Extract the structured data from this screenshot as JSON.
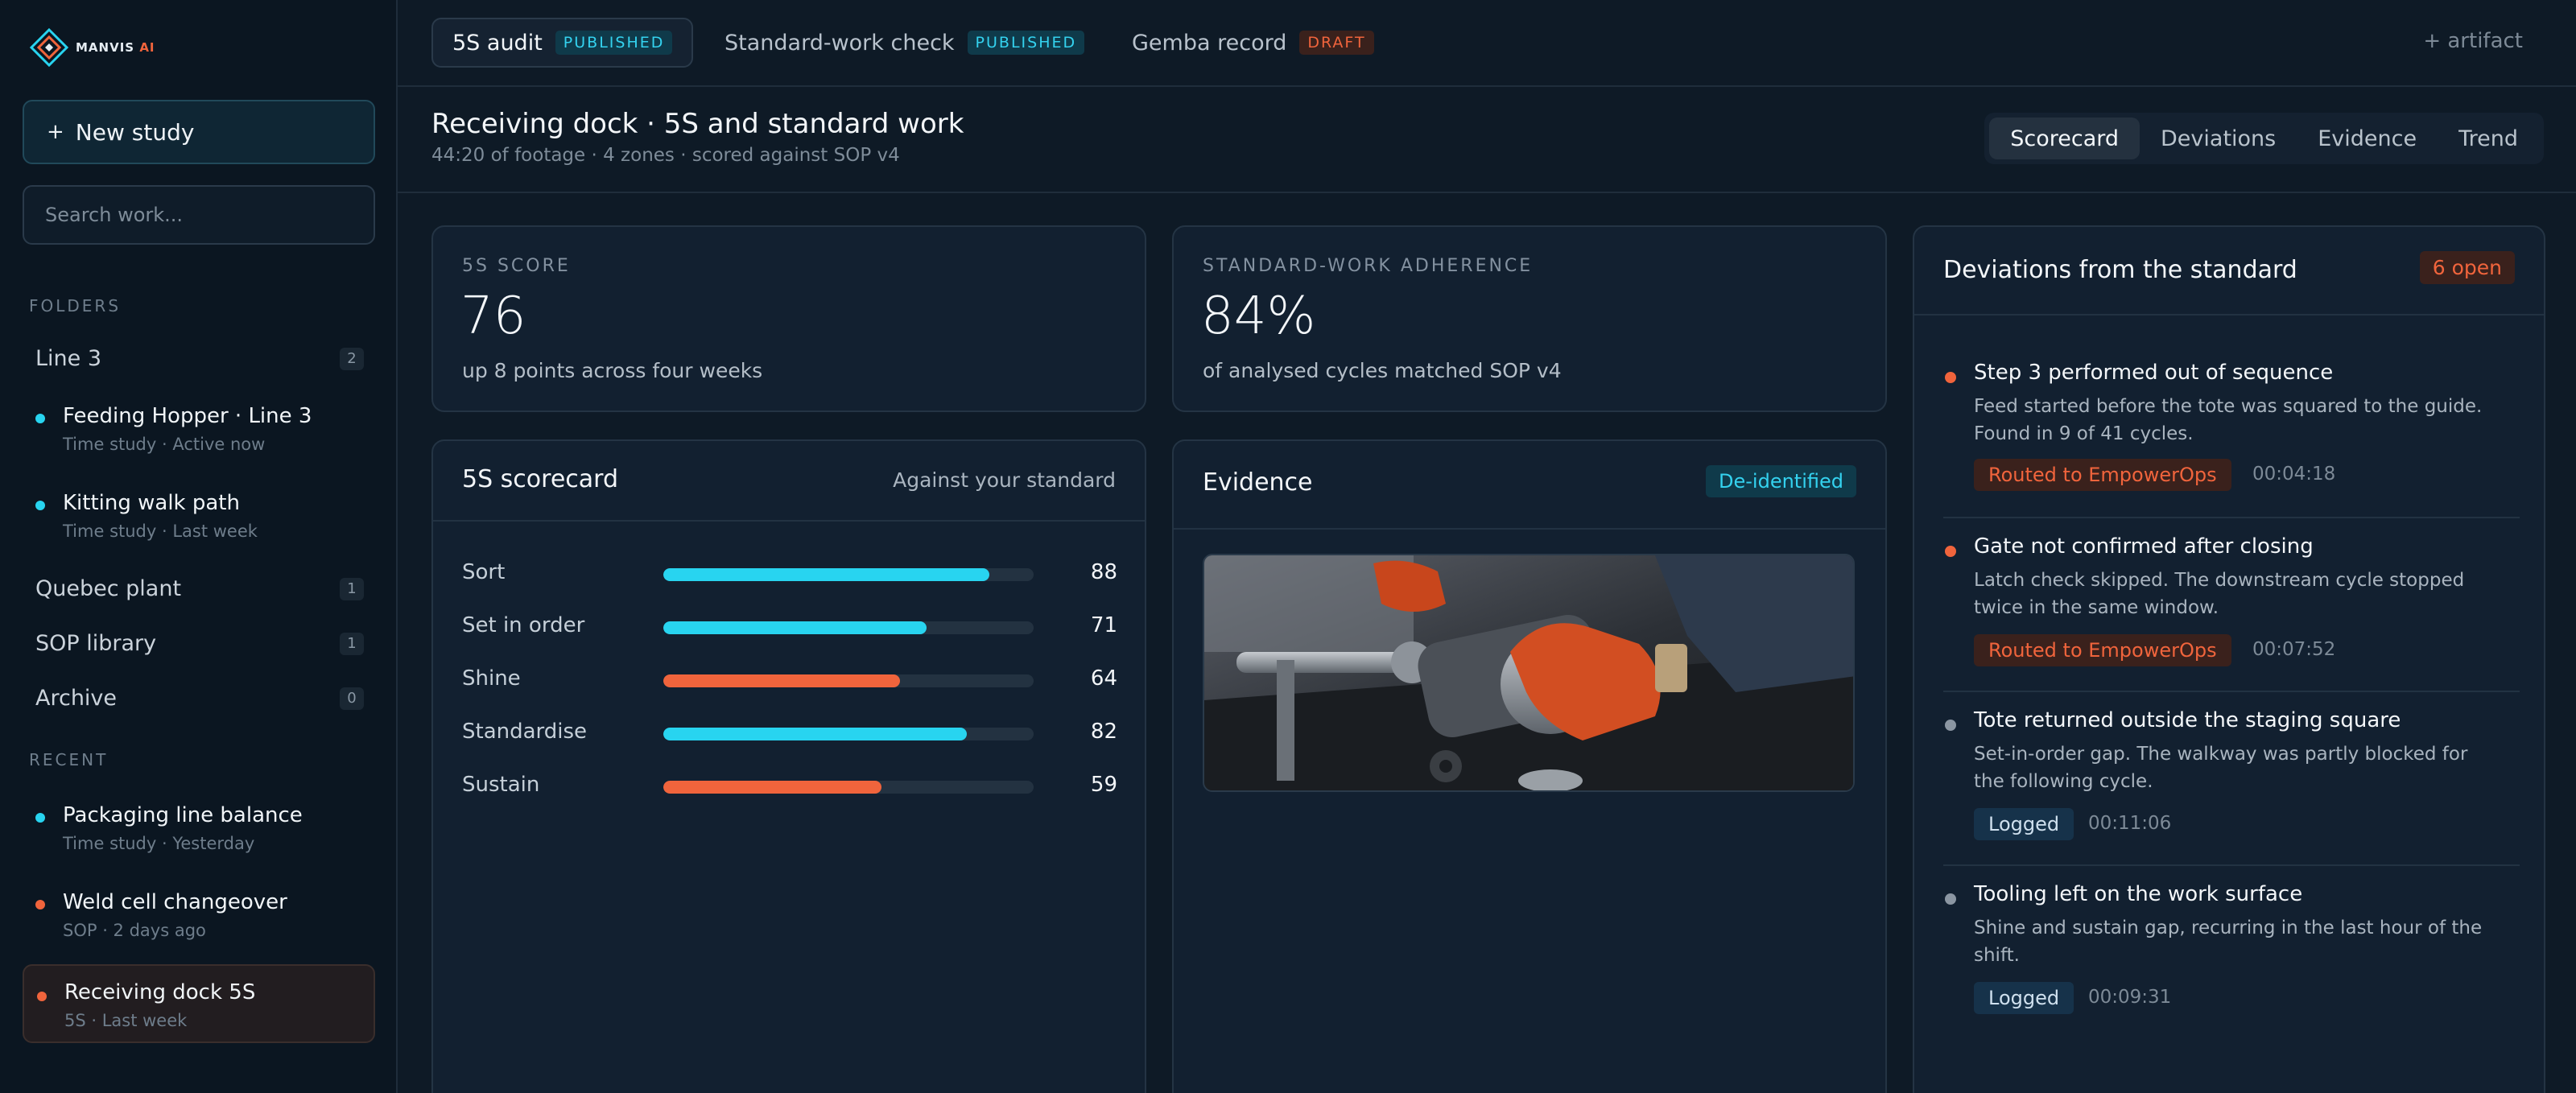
{
  "app": {
    "brand_name": "MANVIS",
    "brand_suffix": "AI"
  },
  "colors": {
    "accent_cyan": "#28d4f0",
    "accent_orange": "#f0643c",
    "neutral_dot": "#8b96a2"
  },
  "sidebar": {
    "new_study_label": "New study",
    "search_placeholder": "Search work...",
    "folders_heading": "FOLDERS",
    "recent_heading": "RECENT",
    "folders": [
      {
        "label": "Line 3",
        "count": "2"
      },
      {
        "label": "Quebec plant",
        "count": "1"
      },
      {
        "label": "SOP library",
        "count": "1"
      },
      {
        "label": "Archive",
        "count": "0"
      }
    ],
    "folder_studies": [
      {
        "title": "Feeding Hopper · Line 3",
        "sub": "Time study · Active now",
        "dot": "cyan"
      },
      {
        "title": "Kitting walk path",
        "sub": "Time study · Last week",
        "dot": "cyan"
      }
    ],
    "recent": [
      {
        "title": "Packaging line balance",
        "sub": "Time study · Yesterday",
        "dot": "cyan"
      },
      {
        "title": "Weld cell changeover",
        "sub": "SOP · 2 days ago",
        "dot": "orange"
      },
      {
        "title": "Receiving dock 5S",
        "sub": "5S · Last week",
        "dot": "orange"
      }
    ]
  },
  "artifact_tabs": [
    {
      "label": "5S audit",
      "status": "PUBLISHED"
    },
    {
      "label": "Standard-work check",
      "status": "PUBLISHED"
    },
    {
      "label": "Gemba record",
      "status": "DRAFT"
    }
  ],
  "add_artifact_label": "+ artifact",
  "header": {
    "title": "Receiving dock · 5S and standard work",
    "subtitle": "44:20 of footage · 4 zones · scored against SOP v4"
  },
  "view_tabs": [
    "Scorecard",
    "Deviations",
    "Evidence",
    "Trend"
  ],
  "metrics": {
    "score": {
      "label": "5S SCORE",
      "value": "76",
      "note": "up 8 points across four weeks"
    },
    "adherence": {
      "label": "STANDARD-WORK ADHERENCE",
      "value": "84%",
      "note": "of analysed cycles matched SOP v4"
    }
  },
  "scorecard": {
    "title": "5S scorecard",
    "aside": "Against your standard",
    "rows": [
      {
        "label": "Sort",
        "value": 88,
        "color": "cyan"
      },
      {
        "label": "Set in order",
        "value": 71,
        "color": "cyan"
      },
      {
        "label": "Shine",
        "value": 64,
        "color": "orange"
      },
      {
        "label": "Standardise",
        "value": 82,
        "color": "cyan"
      },
      {
        "label": "Sustain",
        "value": 59,
        "color": "orange"
      }
    ]
  },
  "evidence": {
    "title": "Evidence",
    "badge": "De-identified"
  },
  "deviations": {
    "title": "Deviations from the standard",
    "open_badge": "6 open",
    "items": [
      {
        "title": "Step 3 performed out of sequence",
        "desc": "Feed started before the tote was squared to the guide. Found in 9 of 41 cycles.",
        "tag": "Routed to EmpowerOps",
        "time": "00:04:18",
        "severity": "orange"
      },
      {
        "title": "Gate not confirmed after closing",
        "desc": "Latch check skipped. The downstream cycle stopped twice in the same window.",
        "tag": "Routed to EmpowerOps",
        "time": "00:07:52",
        "severity": "orange"
      },
      {
        "title": "Tote returned outside the staging square",
        "desc": "Set-in-order gap. The walkway was partly blocked for the following cycle.",
        "tag": "Logged",
        "time": "00:11:06",
        "severity": "neutral"
      },
      {
        "title": "Tooling left on the work surface",
        "desc": "Shine and sustain gap, recurring in the last hour of the shift.",
        "tag": "Logged",
        "time": "00:09:31",
        "severity": "neutral"
      }
    ]
  }
}
